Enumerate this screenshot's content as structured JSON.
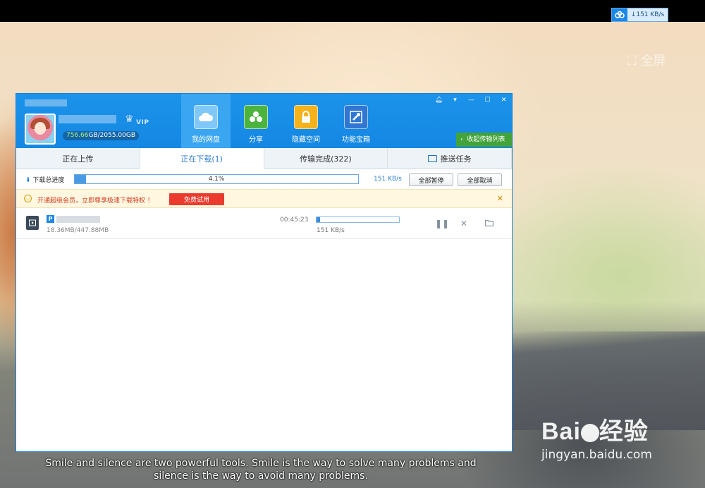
{
  "tray": {
    "speed": "↓151 KB/s"
  },
  "watermark_top": "全屏",
  "account": {
    "quota_used": "756.66",
    "quota_rest": "GB/2055.00GB",
    "vip": "VIP"
  },
  "nav": [
    {
      "label": "我的网盘"
    },
    {
      "label": "分享"
    },
    {
      "label": "隐藏空间"
    },
    {
      "label": "功能宝箱"
    }
  ],
  "collapse_label": "收起传输列表",
  "tabs": [
    {
      "label": "正在上传"
    },
    {
      "label": "正在下载(1)"
    },
    {
      "label": "传输完成(322)"
    },
    {
      "label": "推送任务"
    }
  ],
  "progress": {
    "label": "下载总进度",
    "percent_text": "4.1%",
    "percent": 4.1,
    "speed": "151 KB/s",
    "pause_all": "全部暂停",
    "cancel_all": "全部取消"
  },
  "promo": {
    "text": "开通超级会员，立即尊享极速下载特权 ！",
    "button": "免费试用"
  },
  "task": {
    "badge": "P",
    "size": "18.36MB/447.88MB",
    "eta": "00:45:23",
    "percent": 4.1,
    "speed": "151 KB/s"
  },
  "caption": {
    "line1": "Smile and silence are two powerful tools. Smile is the way to solve many problems and",
    "line2": "silence is the way to avoid many problems."
  },
  "brand": {
    "logo_a": "Bai",
    "logo_b": "经验",
    "url": "jingyan.baidu.com"
  }
}
